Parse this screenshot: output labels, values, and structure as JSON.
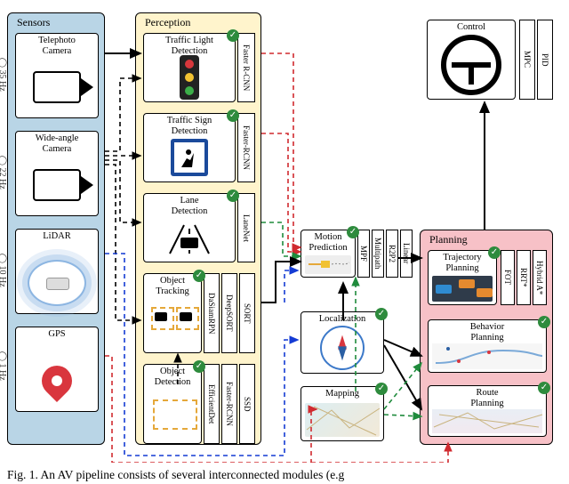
{
  "sensors": {
    "title": "Sensors",
    "items": [
      {
        "label": "Telephoto\nCamera",
        "hz": "◯ 35 Hz"
      },
      {
        "label": "Wide-angle\nCamera",
        "hz": "◯ 22 Hz"
      },
      {
        "label": "LiDAR",
        "hz": "◯ 10 Hz"
      },
      {
        "label": "GPS",
        "hz": "◯ 1 Hz"
      }
    ]
  },
  "perception": {
    "title": "Perception",
    "items": [
      {
        "label": "Traffic Light\nDetection",
        "impls": [
          "Faster R-CNN"
        ]
      },
      {
        "label": "Traffic Sign\nDetection",
        "impls": [
          "Faster-RCNN"
        ]
      },
      {
        "label": "Lane\nDetection",
        "impls": [
          "LaneNet"
        ]
      },
      {
        "label": "Object Tracking",
        "impls": [
          "DaSiamRPN",
          "DeepSORT",
          "SORT"
        ]
      },
      {
        "label": "Object\nDetection",
        "impls": [
          "EfficientDet",
          "Faster-RCNN",
          "SSD"
        ]
      }
    ]
  },
  "mid": {
    "motion": {
      "label": "Motion\nPrediction",
      "impls": [
        "MPF",
        "Multipath",
        "R2P2",
        "Linear"
      ]
    },
    "localization": {
      "label": "Localization"
    },
    "mapping": {
      "label": "Mapping"
    }
  },
  "planning": {
    "title": "Planning",
    "items": [
      {
        "label": "Trajectory\nPlanning",
        "impls": [
          "FOT",
          "RRT*",
          "Hybrid A*"
        ]
      },
      {
        "label": "Behavior\nPlanning",
        "impls": []
      },
      {
        "label": "Route\nPlanning",
        "impls": []
      }
    ]
  },
  "control": {
    "title": "Control",
    "impls": [
      "MPC",
      "PID"
    ]
  },
  "caption": "Fig. 1.   An AV pipeline consists of several interconnected modules (e.g"
}
